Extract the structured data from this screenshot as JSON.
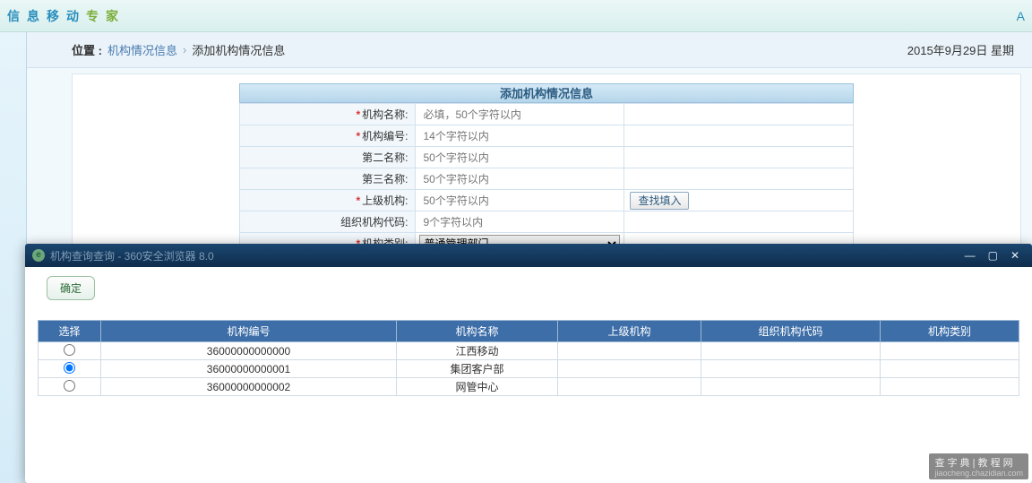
{
  "topbar": {
    "chars": [
      "信",
      "息",
      "移",
      "动",
      "专",
      "家"
    ],
    "right": "A"
  },
  "breadcrumb": {
    "location_label": "位置 :",
    "item1": "机构情况信息",
    "sep": "›",
    "item2": "添加机构情况信息",
    "date": "2015年9月29日 星期"
  },
  "form": {
    "title": "添加机构情况信息",
    "rows": [
      {
        "required": true,
        "label": "机构名称:",
        "placeholder": "必填，50个字符以内",
        "type": "text"
      },
      {
        "required": true,
        "label": "机构编号:",
        "placeholder": "14个字符以内",
        "type": "text"
      },
      {
        "required": false,
        "label": "第二名称:",
        "placeholder": "50个字符以内",
        "type": "text"
      },
      {
        "required": false,
        "label": "第三名称:",
        "placeholder": "50个字符以内",
        "type": "text"
      },
      {
        "required": true,
        "label": "上级机构:",
        "placeholder": "50个字符以内",
        "type": "text",
        "lookup": true
      },
      {
        "required": false,
        "label": "组织机构代码:",
        "placeholder": "9个字符以内",
        "type": "text"
      },
      {
        "required": true,
        "label": "机构类别:",
        "placeholder": "",
        "type": "select",
        "selected": "普通管理部门"
      }
    ],
    "lookup_btn": "查找填入"
  },
  "dialog": {
    "title": "机构查询查询 - 360安全浏览器 8.0",
    "confirm": "确定",
    "columns": [
      "选择",
      "机构编号",
      "机构名称",
      "上级机构",
      "组织机构代码",
      "机构类别"
    ],
    "rows": [
      {
        "selected": false,
        "code": "36000000000000",
        "name": "江西移动",
        "parent": "",
        "org": "",
        "type": ""
      },
      {
        "selected": true,
        "code": "36000000000001",
        "name": "集团客户部",
        "parent": "",
        "org": "",
        "type": ""
      },
      {
        "selected": false,
        "code": "36000000000002",
        "name": "网管中心",
        "parent": "",
        "org": "",
        "type": ""
      }
    ]
  },
  "watermark": {
    "main": "查 字 典 | 教 程 网",
    "sub": "jiaocheng.chazidian.com"
  }
}
